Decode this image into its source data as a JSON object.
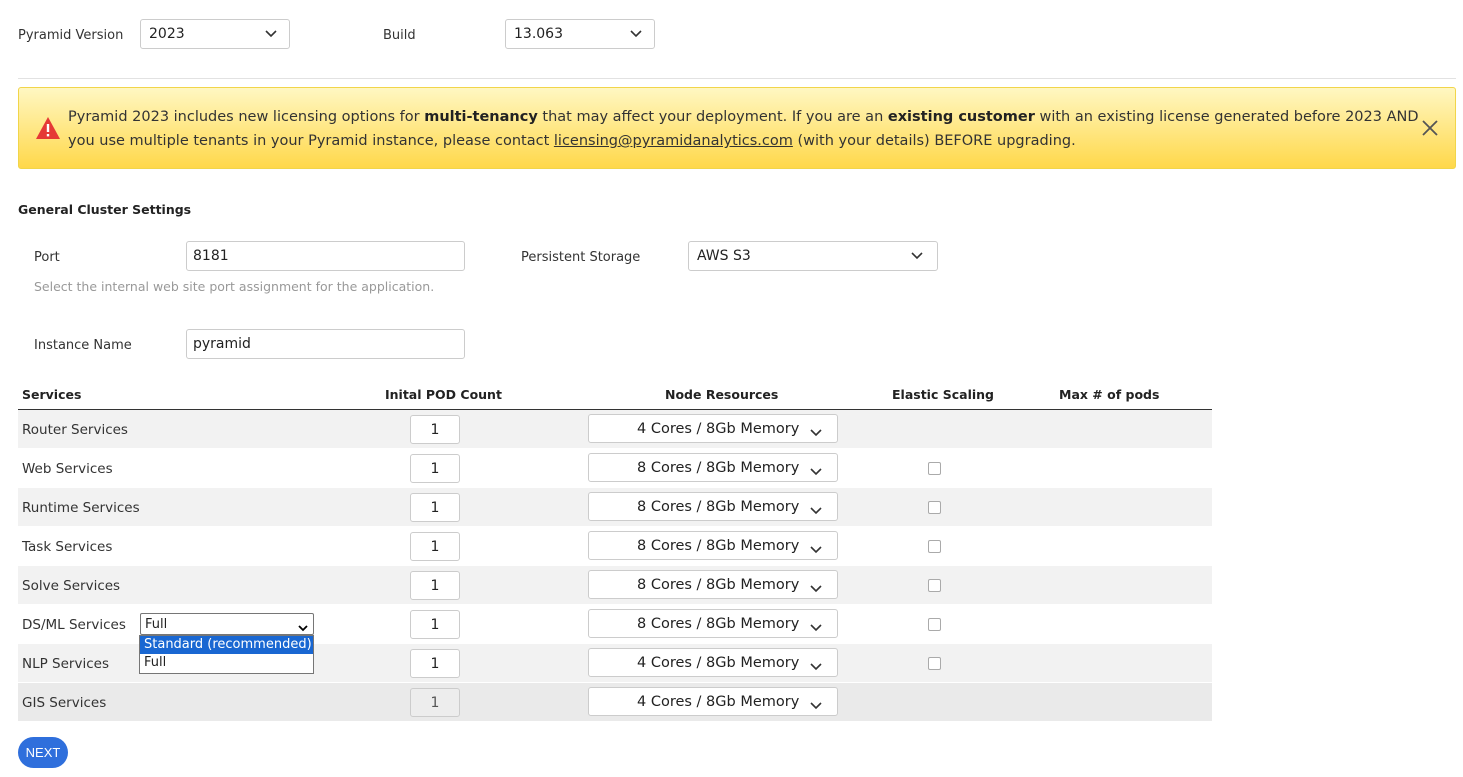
{
  "header": {
    "pyramid_version_label": "Pyramid Version",
    "pyramid_version_value": "2023",
    "build_label": "Build",
    "build_value": "13.063"
  },
  "alert": {
    "text_1": "Pyramid 2023 includes new licensing options for ",
    "bold_1": "multi-tenancy",
    "text_2": " that may affect your deployment. If you are an ",
    "bold_2": "existing customer",
    "text_3": " with an existing license generated before 2023 AND you use multiple tenants in your Pyramid instance, please contact ",
    "email": "licensing@pyramidanalytics.com",
    "text_4": " (with your details) BEFORE upgrading.",
    "icon": "warning-icon",
    "color": "#ffd84a"
  },
  "general": {
    "title": "General Cluster Settings",
    "port_label": "Port",
    "port_value": "8181",
    "port_hint": "Select the internal web site port assignment for the application.",
    "storage_label": "Persistent Storage",
    "storage_value": "AWS S3",
    "instance_label": "Instance Name",
    "instance_value": "pyramid"
  },
  "table": {
    "headers": {
      "services": "Services",
      "pod_count": "Inital POD Count",
      "node_resources": "Node Resources",
      "elastic_scaling": "Elastic Scaling",
      "max_pods": "Max # of pods"
    },
    "rows": [
      {
        "name": "Router Services",
        "count": "1",
        "resources": "4 Cores / 8Gb Memory"
      },
      {
        "name": "Web Services",
        "count": "1",
        "resources": "8 Cores / 8Gb Memory"
      },
      {
        "name": "Runtime Services",
        "count": "1",
        "resources": "8 Cores / 8Gb Memory"
      },
      {
        "name": "Task Services",
        "count": "1",
        "resources": "8 Cores / 8Gb Memory"
      },
      {
        "name": "Solve Services",
        "count": "1",
        "resources": "8 Cores / 8Gb Memory"
      },
      {
        "name": "DS/ML Services",
        "count": "1",
        "resources": "8 Cores / 8Gb Memory"
      },
      {
        "name": "NLP Services",
        "count": "1",
        "resources": "4 Cores / 8Gb Memory"
      },
      {
        "name": "GIS Services",
        "count": "1",
        "resources": "4 Cores / 8Gb Memory"
      }
    ],
    "dsml_mode": {
      "selected": "Full",
      "options": [
        "Standard (recommended)",
        "Full"
      ],
      "highlighted": "Standard (recommended)"
    }
  },
  "next_label": "NEXT",
  "colors": {
    "accent": "#2f6fdc",
    "dropdown_highlight": "#1967d2",
    "warning_icon": "#e53935"
  }
}
